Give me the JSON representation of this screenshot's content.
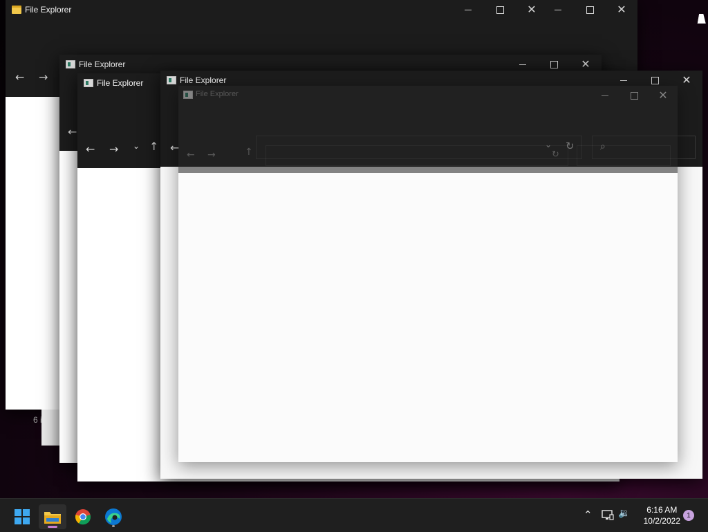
{
  "windows": [
    {
      "title": "File Explorer"
    },
    {
      "title": "File Explorer"
    },
    {
      "title": "File Explorer"
    },
    {
      "title": "File Explorer"
    },
    {
      "title": "File Explorer"
    }
  ],
  "status_fragment": "6 i",
  "taskbar": {
    "time": "6:16 AM",
    "date": "10/2/2022",
    "notification_count": "1"
  },
  "icons": {
    "back": "←",
    "forward": "→",
    "up": "↑",
    "recent": "⌄",
    "refresh": "↻",
    "search": "⌕",
    "close": "✕",
    "tray_chevron": "⌃",
    "volume": "🔉"
  },
  "colors": {
    "accent": "#3ea8f0",
    "titlebar": "#1c1c1c",
    "taskbar": "#1f1f1f"
  }
}
